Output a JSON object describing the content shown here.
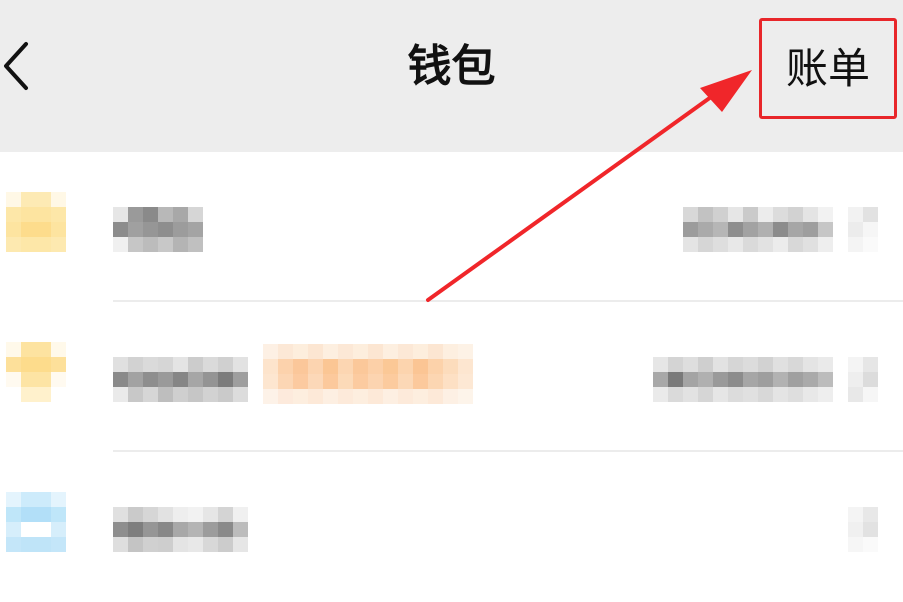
{
  "header": {
    "back_icon": "chevron-left-icon",
    "title": "钱包",
    "bill_button_label": "账单"
  },
  "annotation": {
    "highlight_color": "#e8262a",
    "arrow_color": "#f0262a"
  },
  "list": {
    "items": [
      {
        "icon_color": "#fde7a8",
        "blurred": true
      },
      {
        "icon_color": "#fde3a0",
        "badge_color": "#fcd9b4",
        "blurred": true
      },
      {
        "icon_color": "#bfe6f9",
        "blurred": true
      }
    ]
  }
}
